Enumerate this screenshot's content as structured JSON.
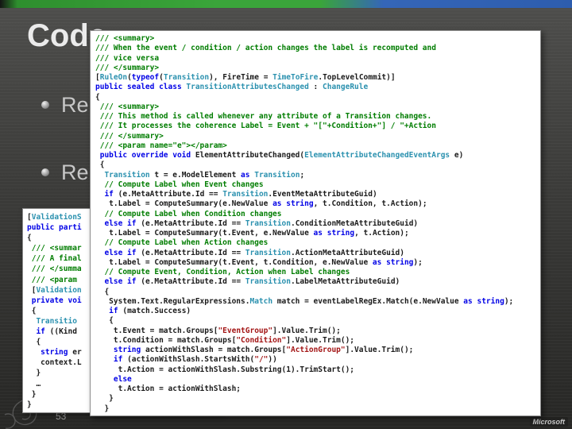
{
  "slide": {
    "title": "Code",
    "bullets": [
      "Re",
      "Re"
    ],
    "page_number": "53",
    "logo": "Microsoft"
  },
  "colors": {
    "keyword": "#0000e6",
    "type": "#2b91af",
    "comment": "#007d00",
    "string": "#a31515",
    "plain": "#1a1a1a",
    "accent_green": "#3aa53a",
    "accent_blue": "#2d5dae"
  },
  "icons": {
    "bullet": "sphere-bullet",
    "corner_ornament": "spiral-flourish"
  },
  "code_windows": {
    "main": {
      "lines": [
        [
          {
            "t": "/// <summary>",
            "c": "c"
          }
        ],
        [
          {
            "t": "/// When the event / condition / action changes the label is recomputed and",
            "c": "c"
          }
        ],
        [
          {
            "t": "/// vice versa",
            "c": "c"
          }
        ],
        [
          {
            "t": "/// </summary>",
            "c": "c"
          }
        ],
        [
          {
            "t": "[",
            "c": "p"
          },
          {
            "t": "RuleOn",
            "c": "t"
          },
          {
            "t": "(",
            "c": "p"
          },
          {
            "t": "typeof",
            "c": "k"
          },
          {
            "t": "(",
            "c": "p"
          },
          {
            "t": "Transition",
            "c": "t"
          },
          {
            "t": "), FireTime = ",
            "c": "p"
          },
          {
            "t": "TimeToFire",
            "c": "t"
          },
          {
            "t": ".TopLevelCommit)]",
            "c": "p"
          }
        ],
        [
          {
            "t": "public sealed class ",
            "c": "k"
          },
          {
            "t": "TransitionAttributesChanged",
            "c": "t"
          },
          {
            "t": " : ",
            "c": "p"
          },
          {
            "t": "ChangeRule",
            "c": "t"
          }
        ],
        [
          {
            "t": "{",
            "c": "p"
          }
        ],
        [
          {
            "t": " /// <summary>",
            "c": "c"
          }
        ],
        [
          {
            "t": " /// This method is called whenever any attribute of a Transition changes.",
            "c": "c"
          }
        ],
        [
          {
            "t": " /// It processes the coherence Label = Event + \"[\"+Condition+\"] / \"+Action",
            "c": "c"
          }
        ],
        [
          {
            "t": " /// </summary>",
            "c": "c"
          }
        ],
        [
          {
            "t": " /// <param name=\"e\"></param>",
            "c": "c"
          }
        ],
        [
          {
            "t": " public override void",
            "c": "k"
          },
          {
            "t": " ElementAttributeChanged(",
            "c": "p"
          },
          {
            "t": "ElementAttributeChangedEventArgs",
            "c": "t"
          },
          {
            "t": " e)",
            "c": "p"
          }
        ],
        [
          {
            "t": " {",
            "c": "p"
          }
        ],
        [
          {
            "t": "  ",
            "c": "p"
          },
          {
            "t": "Transition",
            "c": "t"
          },
          {
            "t": " t = e.ModelElement ",
            "c": "p"
          },
          {
            "t": "as",
            "c": "k"
          },
          {
            "t": " ",
            "c": "p"
          },
          {
            "t": "Transition",
            "c": "t"
          },
          {
            "t": ";",
            "c": "p"
          }
        ],
        [
          {
            "t": "  // Compute Label when Event changes",
            "c": "c"
          }
        ],
        [
          {
            "t": "  ",
            "c": "p"
          },
          {
            "t": "if",
            "c": "k"
          },
          {
            "t": " (e.MetaAttribute.Id == ",
            "c": "p"
          },
          {
            "t": "Transition",
            "c": "t"
          },
          {
            "t": ".EventMetaAttributeGuid)",
            "c": "p"
          }
        ],
        [
          {
            "t": "   t.Label = ComputeSummary(e.NewValue ",
            "c": "p"
          },
          {
            "t": "as",
            "c": "k"
          },
          {
            "t": " ",
            "c": "p"
          },
          {
            "t": "string",
            "c": "k"
          },
          {
            "t": ", t.Condition, t.Action);",
            "c": "p"
          }
        ],
        [
          {
            "t": "  // Compute Label when Condition changes",
            "c": "c"
          }
        ],
        [
          {
            "t": "  ",
            "c": "p"
          },
          {
            "t": "else if",
            "c": "k"
          },
          {
            "t": " (e.MetaAttribute.Id == ",
            "c": "p"
          },
          {
            "t": "Transition",
            "c": "t"
          },
          {
            "t": ".ConditionMetaAttributeGuid)",
            "c": "p"
          }
        ],
        [
          {
            "t": "   t.Label = ComputeSummary(t.Event, e.NewValue ",
            "c": "p"
          },
          {
            "t": "as",
            "c": "k"
          },
          {
            "t": " ",
            "c": "p"
          },
          {
            "t": "string",
            "c": "k"
          },
          {
            "t": ", t.Action);",
            "c": "p"
          }
        ],
        [
          {
            "t": "  // Compute Label when Action changes",
            "c": "c"
          }
        ],
        [
          {
            "t": "  ",
            "c": "p"
          },
          {
            "t": "else if",
            "c": "k"
          },
          {
            "t": " (e.MetaAttribute.Id == ",
            "c": "p"
          },
          {
            "t": "Transition",
            "c": "t"
          },
          {
            "t": ".ActionMetaAttributeGuid)",
            "c": "p"
          }
        ],
        [
          {
            "t": "   t.Label = ComputeSummary(t.Event, t.Condition, e.NewValue ",
            "c": "p"
          },
          {
            "t": "as",
            "c": "k"
          },
          {
            "t": " ",
            "c": "p"
          },
          {
            "t": "string",
            "c": "k"
          },
          {
            "t": ");",
            "c": "p"
          }
        ],
        [
          {
            "t": "  // Compute Event, Condition, Action when Label changes",
            "c": "c"
          }
        ],
        [
          {
            "t": "  ",
            "c": "p"
          },
          {
            "t": "else if",
            "c": "k"
          },
          {
            "t": " (e.MetaAttribute.Id == ",
            "c": "p"
          },
          {
            "t": "Transition",
            "c": "t"
          },
          {
            "t": ".LabelMetaAttributeGuid)",
            "c": "p"
          }
        ],
        [
          {
            "t": "  {",
            "c": "p"
          }
        ],
        [
          {
            "t": "   System.Text.RegularExpressions.",
            "c": "p"
          },
          {
            "t": "Match",
            "c": "t"
          },
          {
            "t": " match = eventLabelRegEx.Match(e.NewValue ",
            "c": "p"
          },
          {
            "t": "as",
            "c": "k"
          },
          {
            "t": " ",
            "c": "p"
          },
          {
            "t": "string",
            "c": "k"
          },
          {
            "t": ");",
            "c": "p"
          }
        ],
        [
          {
            "t": "   ",
            "c": "p"
          },
          {
            "t": "if",
            "c": "k"
          },
          {
            "t": " (match.Success)",
            "c": "p"
          }
        ],
        [
          {
            "t": "   {",
            "c": "p"
          }
        ],
        [
          {
            "t": "    t.Event = match.Groups[",
            "c": "p"
          },
          {
            "t": "\"EventGroup\"",
            "c": "s"
          },
          {
            "t": "].Value.Trim();",
            "c": "p"
          }
        ],
        [
          {
            "t": "    t.Condition = match.Groups[",
            "c": "p"
          },
          {
            "t": "\"Condition\"",
            "c": "s"
          },
          {
            "t": "].Value.Trim();",
            "c": "p"
          }
        ],
        [
          {
            "t": "    ",
            "c": "p"
          },
          {
            "t": "string",
            "c": "k"
          },
          {
            "t": " actionWithSlash = match.Groups[",
            "c": "p"
          },
          {
            "t": "\"ActionGroup\"",
            "c": "s"
          },
          {
            "t": "].Value.Trim();",
            "c": "p"
          }
        ],
        [
          {
            "t": "    ",
            "c": "p"
          },
          {
            "t": "if",
            "c": "k"
          },
          {
            "t": " (actionWithSlash.StartsWith(",
            "c": "p"
          },
          {
            "t": "\"/\"",
            "c": "s"
          },
          {
            "t": "))",
            "c": "p"
          }
        ],
        [
          {
            "t": "     t.Action = actionWithSlash.Substring(1).TrimStart();",
            "c": "p"
          }
        ],
        [
          {
            "t": "    ",
            "c": "p"
          },
          {
            "t": "else",
            "c": "k"
          }
        ],
        [
          {
            "t": "     t.Action = actionWithSlash;",
            "c": "p"
          }
        ],
        [
          {
            "t": "   }",
            "c": "p"
          }
        ],
        [
          {
            "t": "  }",
            "c": "p"
          }
        ]
      ]
    },
    "left": {
      "lines": [
        [
          {
            "t": "[",
            "c": "p"
          },
          {
            "t": "ValidationS",
            "c": "t"
          }
        ],
        [
          {
            "t": "public parti",
            "c": "k"
          }
        ],
        [
          {
            "t": "{",
            "c": "p"
          }
        ],
        [
          {
            "t": " /// <summar",
            "c": "c"
          }
        ],
        [
          {
            "t": " /// A final",
            "c": "c"
          }
        ],
        [
          {
            "t": " /// </summa",
            "c": "c"
          }
        ],
        [
          {
            "t": " /// <param ",
            "c": "c"
          }
        ],
        [
          {
            "t": " [",
            "c": "p"
          },
          {
            "t": "Validation",
            "c": "t"
          }
        ],
        [
          {
            "t": " private voi",
            "c": "k"
          }
        ],
        [
          {
            "t": " {",
            "c": "p"
          }
        ],
        [
          {
            "t": "  ",
            "c": "p"
          },
          {
            "t": "Transitio",
            "c": "t"
          }
        ],
        [
          {
            "t": "  ",
            "c": "p"
          },
          {
            "t": "if",
            "c": "k"
          },
          {
            "t": " ((Kind ",
            "c": "p"
          }
        ],
        [
          {
            "t": "  {",
            "c": "p"
          }
        ],
        [
          {
            "t": "   ",
            "c": "p"
          },
          {
            "t": "string",
            "c": "k"
          },
          {
            "t": " er",
            "c": "p"
          }
        ],
        [
          {
            "t": "   context.L",
            "c": "p"
          }
        ],
        [
          {
            "t": "  }",
            "c": "p"
          }
        ],
        [
          {
            "t": "  …",
            "c": "p"
          }
        ],
        [
          {
            "t": " }",
            "c": "p"
          }
        ],
        [
          {
            "t": "}",
            "c": "p"
          }
        ]
      ]
    }
  }
}
